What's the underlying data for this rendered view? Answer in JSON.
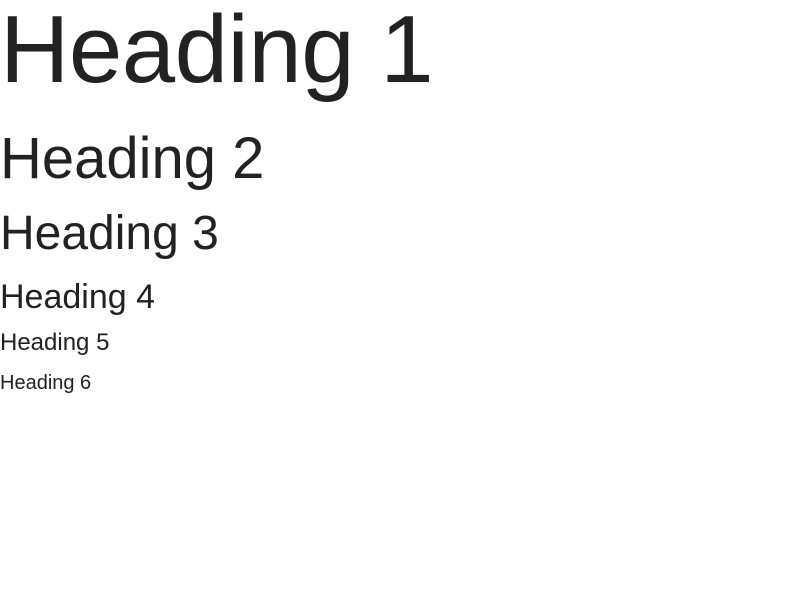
{
  "headings": {
    "h1": "Heading 1",
    "h2": "Heading 2",
    "h3": "Heading 3",
    "h4": "Heading 4",
    "h5": "Heading 5",
    "h6": "Heading 6"
  },
  "colors": {
    "text": "#222222",
    "background": "#ffffff"
  }
}
